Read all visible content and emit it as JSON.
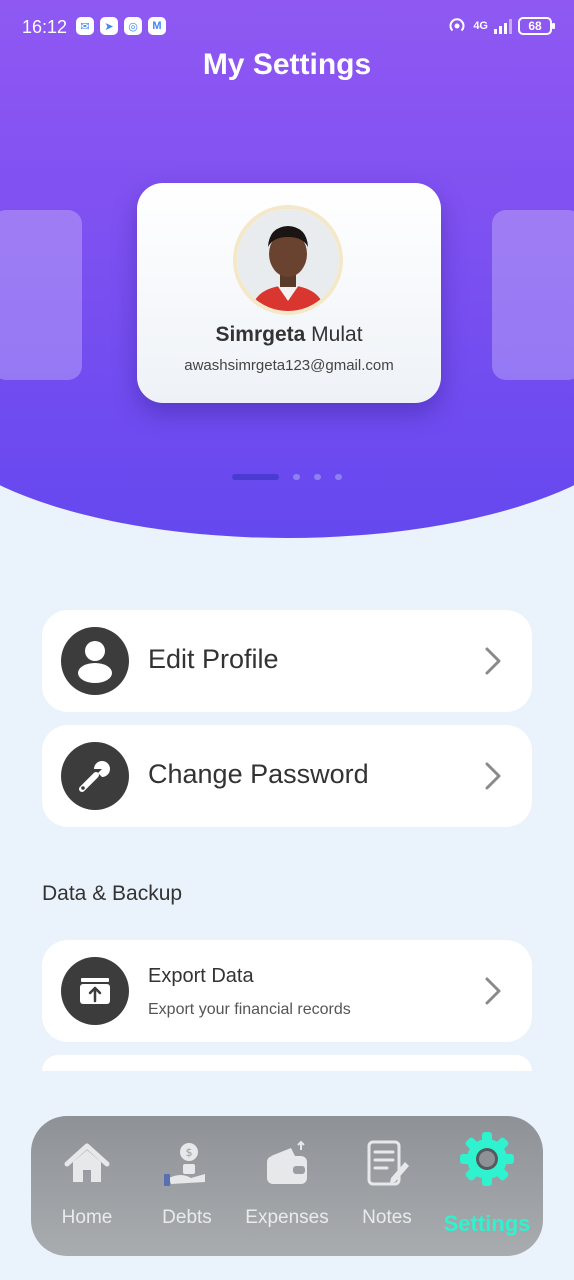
{
  "status_bar": {
    "time": "16:12",
    "network": "4G",
    "battery": "68",
    "notification_icons": [
      "app-icon",
      "telegram-icon",
      "chrome-icon",
      "mail-icon"
    ]
  },
  "header": {
    "title": "My Settings"
  },
  "profile": {
    "first_name": "Simrgeta",
    "last_name": "Mulat",
    "email": "awashsimrgeta123@gmail.com"
  },
  "carousel": {
    "pages": 4,
    "active_index": 0
  },
  "menu": {
    "edit_profile": "Edit Profile",
    "change_password": "Change Password",
    "section_data_backup": "Data & Backup",
    "export_data_title": "Export Data",
    "export_data_desc": "Export your financial records"
  },
  "nav": {
    "items": [
      {
        "label": "Home",
        "icon": "home-icon"
      },
      {
        "label": "Debts",
        "icon": "debts-icon"
      },
      {
        "label": "Expenses",
        "icon": "wallet-icon"
      },
      {
        "label": "Notes",
        "icon": "notes-icon"
      },
      {
        "label": "Settings",
        "icon": "gear-icon"
      }
    ],
    "active": "Settings"
  },
  "colors": {
    "header_top": "#a466f4",
    "header_bottom": "#6548ef",
    "background": "#eaf3fb",
    "nav_active": "#2ff2cf",
    "icon_dark": "#3c3c3c"
  }
}
